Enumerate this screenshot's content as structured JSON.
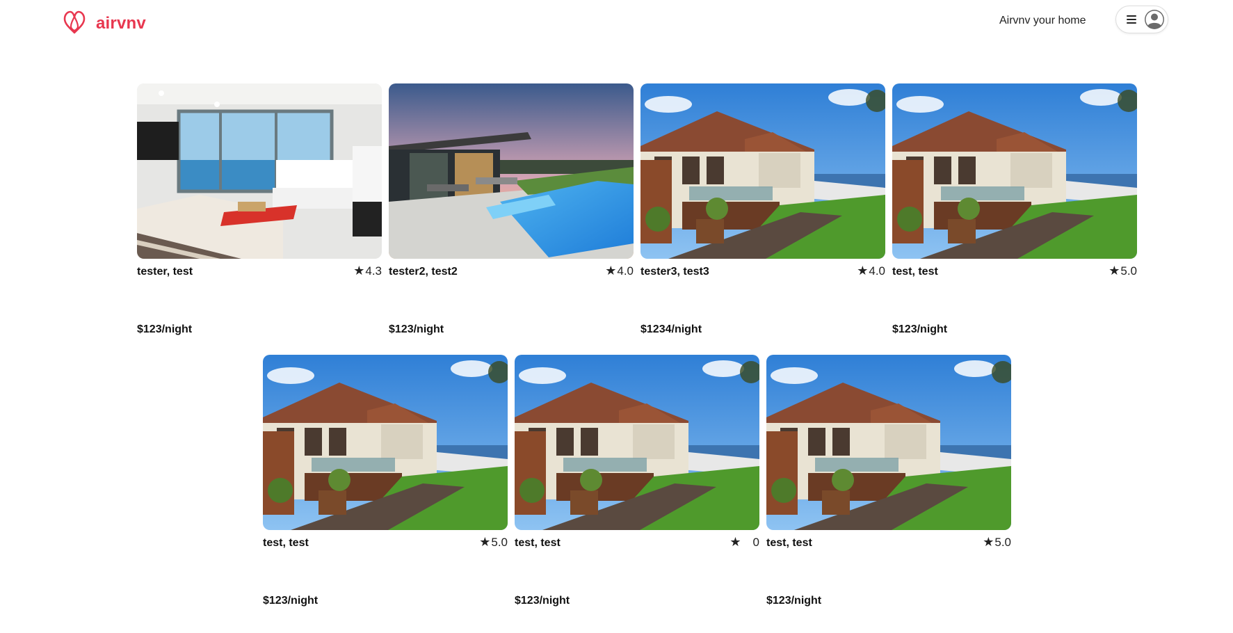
{
  "header": {
    "brand": "airvnv",
    "brand_color": "#e8374f",
    "logo_icon": "airvnv-logo-icon",
    "host_link": "Airvnv your home",
    "menu_icon": "hamburger-menu-icon",
    "avatar_icon": "user-avatar-icon"
  },
  "listings": [
    {
      "title": "tester, test",
      "rating": "4.3",
      "price": "$123/night",
      "image": "bedroom-ocean-view"
    },
    {
      "title": "tester2, test2",
      "rating": "4.0",
      "price": "$123/night",
      "image": "pool-sunset-house"
    },
    {
      "title": "tester3, test3",
      "rating": "4.0",
      "price": "$1234/night",
      "image": "beach-house"
    },
    {
      "title": "test, test",
      "rating": "5.0",
      "price": "$123/night",
      "image": "beach-house"
    },
    {
      "title": "test, test",
      "rating": "5.0",
      "price": "$123/night",
      "image": "beach-house"
    },
    {
      "title": "test, test",
      "rating": "0",
      "price": "$123/night",
      "image": "beach-house"
    },
    {
      "title": "test, test",
      "rating": "5.0",
      "price": "$123/night",
      "image": "beach-house"
    }
  ],
  "rating_symbol": "★"
}
